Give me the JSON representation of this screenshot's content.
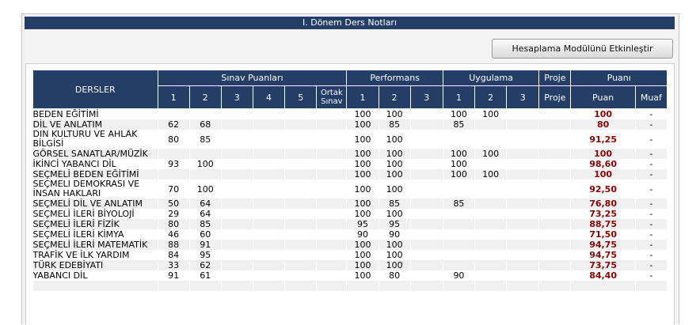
{
  "title": "I. Dönem Ders Notları",
  "calc_button_label": "Hesaplama Modülünü Etkinleştir",
  "headers": {
    "courses": "DERSLER",
    "exam_group": "Sınav Puanları",
    "performance_group": "Performans",
    "application_group": "Uygulama",
    "project_group": "Proje",
    "score_group": "Puanı",
    "exam_cols": [
      "1",
      "2",
      "3",
      "4",
      "5",
      "Ortak Sınav"
    ],
    "performance_cols": [
      "1",
      "2",
      "3"
    ],
    "application_cols": [
      "1",
      "2",
      "3"
    ],
    "project_col": "Proje",
    "score_col": "Puan",
    "exempt_col": "Muaf"
  },
  "rows": [
    {
      "course": "BEDEN EĞİTİMİ",
      "exams": [
        "",
        "",
        "",
        "",
        "",
        ""
      ],
      "performance": [
        "100",
        "100",
        ""
      ],
      "application": [
        "100",
        "100",
        ""
      ],
      "project": "",
      "score": "100",
      "exempt": "-"
    },
    {
      "course": "DİL VE ANLATIM",
      "exams": [
        "62",
        "68",
        "",
        "",
        "",
        ""
      ],
      "performance": [
        "100",
        "85",
        ""
      ],
      "application": [
        "85",
        "",
        ""
      ],
      "project": "",
      "score": "80",
      "exempt": "-"
    },
    {
      "course": "DİN KÜLTÜRÜ VE AHLÂK BİLGİSİ",
      "exams": [
        "80",
        "85",
        "",
        "",
        "",
        ""
      ],
      "performance": [
        "100",
        "100",
        ""
      ],
      "application": [
        "",
        "",
        ""
      ],
      "project": "",
      "score": "91,25",
      "exempt": "-"
    },
    {
      "course": "GÖRSEL SANATLAR/MÜZİK",
      "exams": [
        "",
        "",
        "",
        "",
        "",
        ""
      ],
      "performance": [
        "100",
        "100",
        ""
      ],
      "application": [
        "100",
        "100",
        ""
      ],
      "project": "",
      "score": "100",
      "exempt": "-"
    },
    {
      "course": "İKİNCİ YABANCI DİL",
      "exams": [
        "93",
        "100",
        "",
        "",
        "",
        ""
      ],
      "performance": [
        "100",
        "100",
        ""
      ],
      "application": [
        "100",
        "",
        ""
      ],
      "project": "",
      "score": "98,60",
      "exempt": "-"
    },
    {
      "course": "SEÇMELİ BEDEN EĞİTİMİ",
      "exams": [
        "",
        "",
        "",
        "",
        "",
        ""
      ],
      "performance": [
        "100",
        "100",
        ""
      ],
      "application": [
        "100",
        "100",
        ""
      ],
      "project": "",
      "score": "100",
      "exempt": "-"
    },
    {
      "course": "SEÇMELİ DEMOKRASİ VE İNSAN HAKLARI",
      "exams": [
        "70",
        "100",
        "",
        "",
        "",
        ""
      ],
      "performance": [
        "100",
        "100",
        ""
      ],
      "application": [
        "",
        "",
        ""
      ],
      "project": "",
      "score": "92,50",
      "exempt": "-"
    },
    {
      "course": "SEÇMELİ DİL VE ANLATIM",
      "exams": [
        "50",
        "64",
        "",
        "",
        "",
        ""
      ],
      "performance": [
        "100",
        "85",
        ""
      ],
      "application": [
        "85",
        "",
        ""
      ],
      "project": "",
      "score": "76,80",
      "exempt": "-"
    },
    {
      "course": "SEÇMELİ İLERİ BİYOLOJİ",
      "exams": [
        "29",
        "64",
        "",
        "",
        "",
        ""
      ],
      "performance": [
        "100",
        "100",
        ""
      ],
      "application": [
        "",
        "",
        ""
      ],
      "project": "",
      "score": "73,25",
      "exempt": "-"
    },
    {
      "course": "SEÇMELİ İLERİ FİZİK",
      "exams": [
        "80",
        "85",
        "",
        "",
        "",
        ""
      ],
      "performance": [
        "95",
        "95",
        ""
      ],
      "application": [
        "",
        "",
        ""
      ],
      "project": "",
      "score": "88,75",
      "exempt": "-"
    },
    {
      "course": "SEÇMELİ İLERİ KİMYA",
      "exams": [
        "46",
        "60",
        "",
        "",
        "",
        ""
      ],
      "performance": [
        "90",
        "90",
        ""
      ],
      "application": [
        "",
        "",
        ""
      ],
      "project": "",
      "score": "71,50",
      "exempt": "-"
    },
    {
      "course": "SEÇMELİ İLERİ MATEMATİK",
      "exams": [
        "88",
        "91",
        "",
        "",
        "",
        ""
      ],
      "performance": [
        "100",
        "100",
        ""
      ],
      "application": [
        "",
        "",
        ""
      ],
      "project": "",
      "score": "94,75",
      "exempt": "-"
    },
    {
      "course": "TRAFİK VE İLK YARDIM",
      "exams": [
        "84",
        "95",
        "",
        "",
        "",
        ""
      ],
      "performance": [
        "100",
        "100",
        ""
      ],
      "application": [
        "",
        "",
        ""
      ],
      "project": "",
      "score": "94,75",
      "exempt": "-"
    },
    {
      "course": "TÜRK EDEBİYATI",
      "exams": [
        "33",
        "62",
        "",
        "",
        "",
        ""
      ],
      "performance": [
        "100",
        "100",
        ""
      ],
      "application": [
        "",
        "",
        ""
      ],
      "project": "",
      "score": "73,75",
      "exempt": "-"
    },
    {
      "course": "YABANCI DİL",
      "exams": [
        "91",
        "61",
        "",
        "",
        "",
        ""
      ],
      "performance": [
        "100",
        "80",
        ""
      ],
      "application": [
        "90",
        "",
        ""
      ],
      "project": "",
      "score": "84,40",
      "exempt": "-"
    },
    {
      "course": "",
      "exams": [
        "",
        "",
        "",
        "",
        "",
        ""
      ],
      "performance": [
        "",
        "",
        ""
      ],
      "application": [
        "",
        "",
        ""
      ],
      "project": "",
      "score": "",
      "exempt": ""
    }
  ]
}
